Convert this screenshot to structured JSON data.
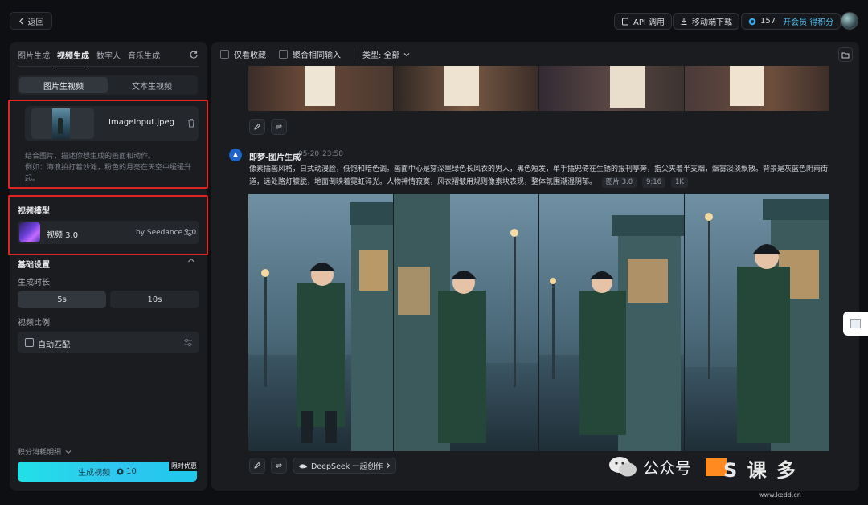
{
  "header": {
    "back_label": "返回",
    "api_label": "API 调用",
    "download_label": "移动端下载",
    "credits": "157",
    "vip_label": "开会员 得积分"
  },
  "left": {
    "mode_tabs": [
      "图片生成",
      "视频生成",
      "数字人",
      "音乐生成"
    ],
    "sub_tabs": [
      "图片生视频",
      "文本生视频"
    ],
    "upload": {
      "file_name": "ImageInput.jpeg"
    },
    "hint_line1": "结合图片，描述你想生成的画面和动作。",
    "hint_line2": "例如：海浪拍打着沙滩，粉色的月亮在天空中缓缓升起。",
    "model_section": "视频模型",
    "model_name": "视频 3.0",
    "model_by": "by Seedance 1.0",
    "basic_settings": "基础设置",
    "duration_label": "生成时长",
    "duration_options": [
      "5s",
      "10s"
    ],
    "ratio_label": "视频比例",
    "ratio_value": "自动匹配",
    "credit_detail": "积分消耗明细",
    "generate_label": "生成视频",
    "generate_cost": "10",
    "promo_badge": "限时优惠"
  },
  "right": {
    "filter_fav": "仅看收藏",
    "filter_merge": "聚合相同输入",
    "filter_type": "类型: 全部",
    "entry_title": "即梦-图片生成",
    "entry_date": "05-20",
    "entry_time": "23:58",
    "prompt": "像素插画风格，日式动漫脸，低饱和暗色调。画面中心是穿深墨绿色长风衣的男人，黑色短发，单手插兜倚在生锈的报刊亭旁，指尖夹着半支烟，烟雾淡淡飘散。背景是灰蓝色阴雨街道，远处路灯朦胧，地面倒映着霓虹碎光。人物神情寂寞，风衣褶皱用规则像素块表现，整体氛围潮湿阴郁。",
    "tags": [
      "图片 3.0",
      "9:16",
      "1K"
    ],
    "deepseek_label": "DeepSeek 一起创作"
  },
  "watermark": {
    "wechat": "公众号",
    "brand": "S 课 多",
    "url": "www.kedd.cn"
  },
  "colors": {
    "accent": "#21e0e6",
    "highlight_box": "#e02424",
    "brand_blue": "#1d63c8"
  }
}
